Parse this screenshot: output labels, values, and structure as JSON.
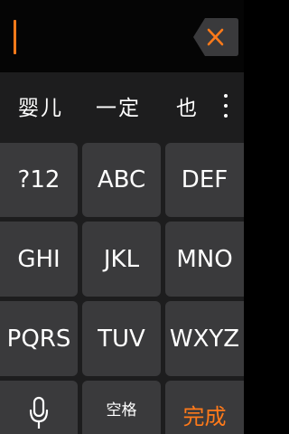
{
  "input": {
    "text": ""
  },
  "candidates": {
    "items": [
      "婴儿",
      "一定",
      "也"
    ]
  },
  "keys": {
    "row1": [
      "?12",
      "ABC",
      "DEF"
    ],
    "row2": [
      "GHI",
      "JKL",
      "MNO"
    ],
    "row3": [
      "PQRS",
      "TUV",
      "WXYZ"
    ],
    "space_label": "空格",
    "done_label": "完成"
  },
  "icons": {
    "backspace": "backspace-icon",
    "more": "more-vertical-icon",
    "microphone": "microphone-icon"
  },
  "colors": {
    "accent": "#ff7a1a",
    "key_background": "#3a3a3c",
    "keyboard_background": "#1d1d1e",
    "text": "#ffffff"
  }
}
